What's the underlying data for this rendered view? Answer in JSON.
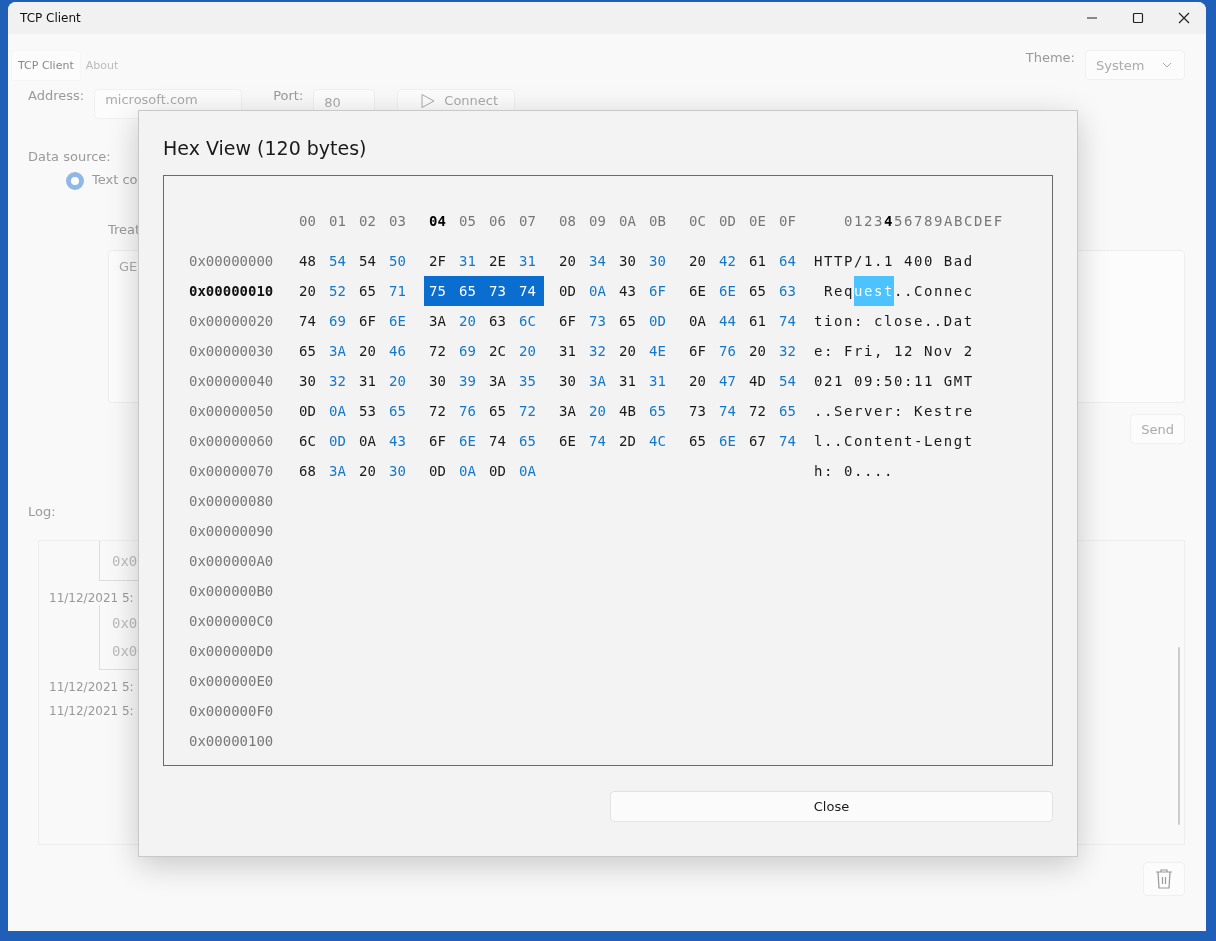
{
  "window": {
    "title": "TCP Client"
  },
  "tabs": [
    {
      "label": "TCP Client",
      "selected": true
    },
    {
      "label": "About",
      "selected": false
    }
  ],
  "theme": {
    "label": "Theme:",
    "value": "System"
  },
  "connection": {
    "address_label": "Address:",
    "address": "microsoft.com",
    "port_label": "Port:",
    "port": "80",
    "connect": "Connect"
  },
  "data_source": {
    "label": "Data source:",
    "option": {
      "label": "Text co",
      "selected": true
    },
    "treat_label": "Treat",
    "text": "GE"
  },
  "send": "Send",
  "log": {
    "label": "Log:",
    "entries": [
      {
        "kind": "hex",
        "lines": [
          "0x0"
        ]
      },
      {
        "kind": "time",
        "text": "11/12/2021 5:"
      },
      {
        "kind": "hex",
        "lines": [
          "0x0",
          "0x0"
        ]
      },
      {
        "kind": "time",
        "text": "11/12/2021 5:"
      },
      {
        "kind": "time",
        "text": "11/12/2021 5:"
      }
    ]
  },
  "hex_dialog": {
    "title": "Hex View (120 bytes)",
    "header": {
      "groups": [
        {
          "labels": [
            {
              "label": "00",
              "selected": false
            },
            {
              "label": "01",
              "selected": false
            },
            {
              "label": "02",
              "selected": false
            },
            {
              "label": "03",
              "selected": false
            }
          ]
        },
        {
          "labels": [
            {
              "label": "04",
              "selected": true
            },
            {
              "label": "05",
              "selected": false
            },
            {
              "label": "06",
              "selected": false
            },
            {
              "label": "07",
              "selected": false
            }
          ]
        },
        {
          "labels": [
            {
              "label": "08",
              "selected": false
            },
            {
              "label": "09",
              "selected": false
            },
            {
              "label": "0A",
              "selected": false
            },
            {
              "label": "0B",
              "selected": false
            }
          ]
        },
        {
          "labels": [
            {
              "label": "0C",
              "selected": false
            },
            {
              "label": "0D",
              "selected": false
            },
            {
              "label": "0E",
              "selected": false
            },
            {
              "label": "0F",
              "selected": false
            }
          ]
        }
      ],
      "ascii": [
        {
          "text": "0123",
          "selected": false
        },
        {
          "text": "4",
          "selected": true
        },
        {
          "text": "56789ABCDEF",
          "selected": false
        }
      ]
    },
    "rows": [
      {
        "offset": "0x00000000",
        "selected": false,
        "groups": [
          {
            "bytes": [
              "48",
              "54",
              "54",
              "50"
            ],
            "selected": false
          },
          {
            "bytes": [
              "2F",
              "31",
              "2E",
              "31"
            ],
            "selected": false
          },
          {
            "bytes": [
              "20",
              "34",
              "30",
              "30"
            ],
            "selected": false
          },
          {
            "bytes": [
              "20",
              "42",
              "61",
              "64"
            ],
            "selected": false
          }
        ],
        "ascii": [
          {
            "text": "HTTP/1.1 400 Bad",
            "selected": false
          }
        ]
      },
      {
        "offset": "0x00000010",
        "selected": true,
        "groups": [
          {
            "bytes": [
              "20",
              "52",
              "65",
              "71"
            ],
            "selected": false
          },
          {
            "bytes": [
              "75",
              "65",
              "73",
              "74"
            ],
            "selected": true
          },
          {
            "bytes": [
              "0D",
              "0A",
              "43",
              "6F"
            ],
            "selected": false
          },
          {
            "bytes": [
              "6E",
              "6E",
              "65",
              "63"
            ],
            "selected": false
          }
        ],
        "ascii": [
          {
            "text": " Req",
            "selected": false
          },
          {
            "text": "uest",
            "selected": true
          },
          {
            "text": "..Connec",
            "selected": false
          }
        ]
      },
      {
        "offset": "0x00000020",
        "selected": false,
        "groups": [
          {
            "bytes": [
              "74",
              "69",
              "6F",
              "6E"
            ],
            "selected": false
          },
          {
            "bytes": [
              "3A",
              "20",
              "63",
              "6C"
            ],
            "selected": false
          },
          {
            "bytes": [
              "6F",
              "73",
              "65",
              "0D"
            ],
            "selected": false
          },
          {
            "bytes": [
              "0A",
              "44",
              "61",
              "74"
            ],
            "selected": false
          }
        ],
        "ascii": [
          {
            "text": "tion: close..Dat",
            "selected": false
          }
        ]
      },
      {
        "offset": "0x00000030",
        "selected": false,
        "groups": [
          {
            "bytes": [
              "65",
              "3A",
              "20",
              "46"
            ],
            "selected": false
          },
          {
            "bytes": [
              "72",
              "69",
              "2C",
              "20"
            ],
            "selected": false
          },
          {
            "bytes": [
              "31",
              "32",
              "20",
              "4E"
            ],
            "selected": false
          },
          {
            "bytes": [
              "6F",
              "76",
              "20",
              "32"
            ],
            "selected": false
          }
        ],
        "ascii": [
          {
            "text": "e: Fri, 12 Nov 2",
            "selected": false
          }
        ]
      },
      {
        "offset": "0x00000040",
        "selected": false,
        "groups": [
          {
            "bytes": [
              "30",
              "32",
              "31",
              "20"
            ],
            "selected": false
          },
          {
            "bytes": [
              "30",
              "39",
              "3A",
              "35"
            ],
            "selected": false
          },
          {
            "bytes": [
              "30",
              "3A",
              "31",
              "31"
            ],
            "selected": false
          },
          {
            "bytes": [
              "20",
              "47",
              "4D",
              "54"
            ],
            "selected": false
          }
        ],
        "ascii": [
          {
            "text": "021 09:50:11 GMT",
            "selected": false
          }
        ]
      },
      {
        "offset": "0x00000050",
        "selected": false,
        "groups": [
          {
            "bytes": [
              "0D",
              "0A",
              "53",
              "65"
            ],
            "selected": false
          },
          {
            "bytes": [
              "72",
              "76",
              "65",
              "72"
            ],
            "selected": false
          },
          {
            "bytes": [
              "3A",
              "20",
              "4B",
              "65"
            ],
            "selected": false
          },
          {
            "bytes": [
              "73",
              "74",
              "72",
              "65"
            ],
            "selected": false
          }
        ],
        "ascii": [
          {
            "text": "..Server: Kestre",
            "selected": false
          }
        ]
      },
      {
        "offset": "0x00000060",
        "selected": false,
        "groups": [
          {
            "bytes": [
              "6C",
              "0D",
              "0A",
              "43"
            ],
            "selected": false
          },
          {
            "bytes": [
              "6F",
              "6E",
              "74",
              "65"
            ],
            "selected": false
          },
          {
            "bytes": [
              "6E",
              "74",
              "2D",
              "4C"
            ],
            "selected": false
          },
          {
            "bytes": [
              "65",
              "6E",
              "67",
              "74"
            ],
            "selected": false
          }
        ],
        "ascii": [
          {
            "text": "l..Content-Lengt",
            "selected": false
          }
        ]
      },
      {
        "offset": "0x00000070",
        "selected": false,
        "groups": [
          {
            "bytes": [
              "68",
              "3A",
              "20",
              "30"
            ],
            "selected": false
          },
          {
            "bytes": [
              "0D",
              "0A",
              "0D",
              "0A"
            ],
            "selected": false
          }
        ],
        "ascii": [
          {
            "text": "h: 0....",
            "selected": false
          }
        ]
      },
      {
        "offset": "0x00000080",
        "selected": false
      },
      {
        "offset": "0x00000090",
        "selected": false
      },
      {
        "offset": "0x000000A0",
        "selected": false
      },
      {
        "offset": "0x000000B0",
        "selected": false
      },
      {
        "offset": "0x000000C0",
        "selected": false
      },
      {
        "offset": "0x000000D0",
        "selected": false
      },
      {
        "offset": "0x000000E0",
        "selected": false
      },
      {
        "offset": "0x000000F0",
        "selected": false
      },
      {
        "offset": "0x00000100",
        "selected": false
      }
    ],
    "close": "Close"
  }
}
